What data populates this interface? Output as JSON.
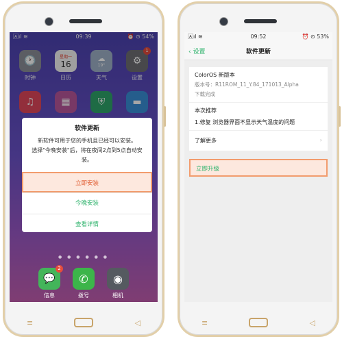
{
  "colors": {
    "accent_green": "#2fb36c",
    "highlight_border": "#f29c6d",
    "highlight_fill": "#fde8de"
  },
  "left": {
    "status": {
      "carrier": "🄰ıl ≋",
      "time": "09:39",
      "battery": "⏰ ⊙ 54%"
    },
    "apps": [
      {
        "label": "时钟",
        "icon": "clock-icon",
        "glyph": "🕐"
      },
      {
        "label": "日历",
        "icon": "calendar-icon",
        "glyph": "16",
        "sub": "星期一"
      },
      {
        "label": "天气",
        "icon": "weather-icon",
        "glyph": "☁",
        "sub": "19°"
      },
      {
        "label": "设置",
        "icon": "settings-icon",
        "glyph": "⚙",
        "badge": "1"
      }
    ],
    "row2": [
      {
        "icon": "music-icon",
        "glyph": "♫"
      },
      {
        "icon": "gallery-icon",
        "glyph": "▦"
      },
      {
        "icon": "security-icon",
        "glyph": "⛨"
      },
      {
        "icon": "files-icon",
        "glyph": "▬"
      }
    ],
    "dialog": {
      "title": "软件更新",
      "message_line1": "新软件可用于您的手机且已经可以安装。",
      "message_line2": "选择\"今晚安装\"后，将在夜间2点到5点自动安装。",
      "install_now": "立即安装",
      "install_tonight": "今晚安装",
      "view_details": "查看详情"
    },
    "dock": [
      {
        "label": "信息",
        "icon": "messages-icon",
        "glyph": "💬",
        "badge": "2"
      },
      {
        "label": "拨号",
        "icon": "phone-icon",
        "glyph": "✆"
      },
      {
        "label": "相机",
        "icon": "camera-icon",
        "glyph": "◉"
      }
    ]
  },
  "right": {
    "status": {
      "carrier": "🄰ıl ≋",
      "time": "09:52",
      "battery": "⏰ ⊙ 53%"
    },
    "back_label": "设置",
    "page_title": "软件更新",
    "version_title": "ColorOS 新版本",
    "version_number": "版本号：R11ROM_11_Y.84_171013_Alpha",
    "download_status": "下载完成",
    "recommend_title": "本次推荐",
    "recommend_item": "1.修复 浏览器界面不显示天气温度的问题",
    "learn_more": "了解更多",
    "upgrade_now": "立即升级"
  }
}
